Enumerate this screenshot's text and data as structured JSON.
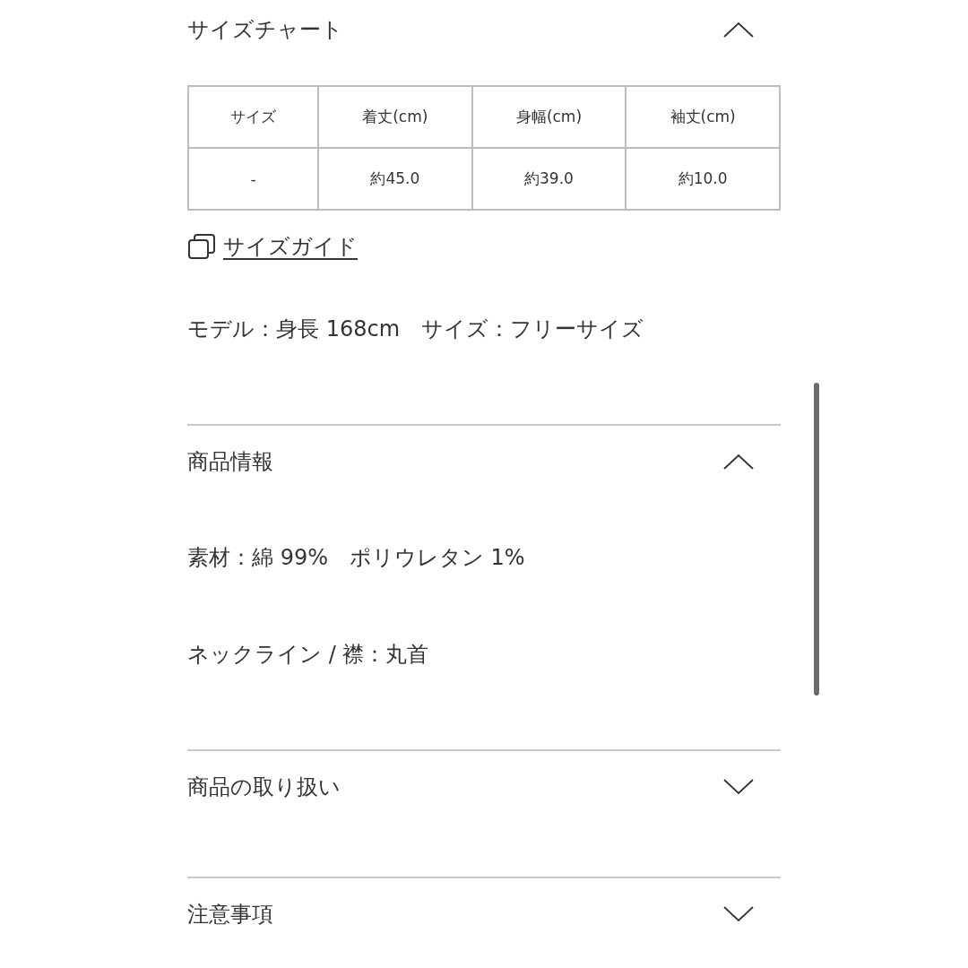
{
  "sections": [
    {
      "kind": "size_chart",
      "title": "サイズチャート",
      "expanded": true,
      "table": {
        "columns": [
          "サイズ",
          "着丈(cm)",
          "身幅(cm)",
          "袖丈(cm)"
        ],
        "rows": [
          [
            "-",
            "約45.0",
            "約39.0",
            "約10.0"
          ]
        ]
      },
      "link": "サイズガイド",
      "note": "モデル：身長 168cm　サイズ：フリーサイズ"
    },
    {
      "kind": "text",
      "title": "商品情報",
      "expanded": true,
      "lines": [
        "素材：綿 99%　ポリウレタン 1%",
        "ネックライン / 襟：丸首"
      ]
    },
    {
      "title": "商品の取り扱い",
      "expanded": false
    },
    {
      "title": "注意事項",
      "expanded": false
    }
  ]
}
